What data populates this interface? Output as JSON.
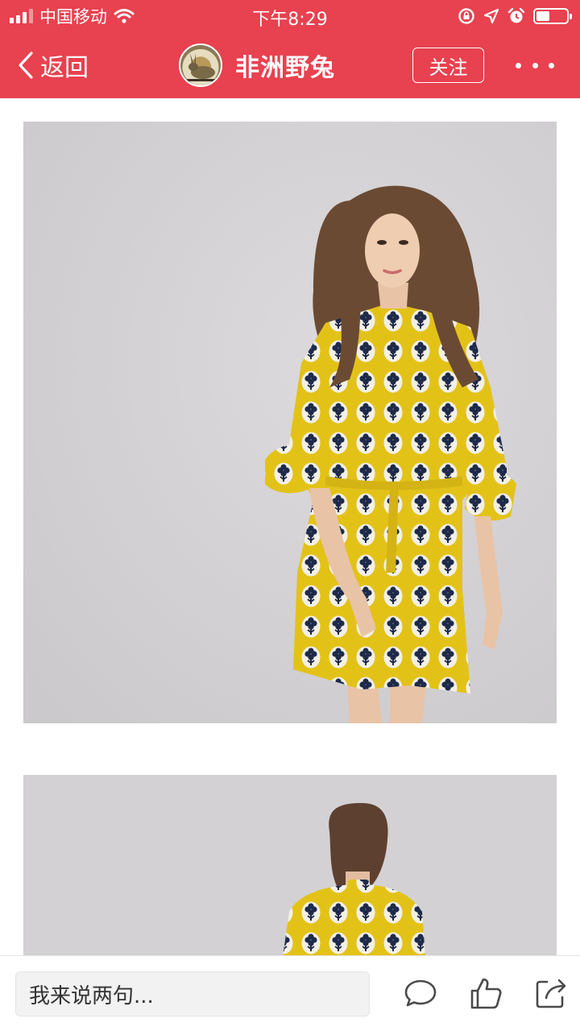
{
  "status_bar": {
    "carrier": "中国移动",
    "time": "下午8:29",
    "icons": [
      "signal-icon",
      "wifi-icon",
      "rotation-lock-icon",
      "location-icon",
      "alarm-icon",
      "battery-icon"
    ],
    "battery_level": 0.45
  },
  "nav": {
    "back_label": "返回",
    "author_name": "非洲野兔",
    "follow_label": "关注",
    "more_icon": "more-dots-icon"
  },
  "content": {
    "images": [
      {
        "description_icon": "model-photo-front"
      },
      {
        "description_icon": "model-photo-back"
      }
    ]
  },
  "bottom_bar": {
    "comment_placeholder": "我来说两句...",
    "icons": [
      "comment-icon",
      "like-icon",
      "share-icon"
    ]
  },
  "colors": {
    "accent": "#e8414f",
    "dress_yellow": "#e3c218",
    "dress_navy": "#1e2a4a",
    "photo_bg": "#d2d0d2"
  }
}
